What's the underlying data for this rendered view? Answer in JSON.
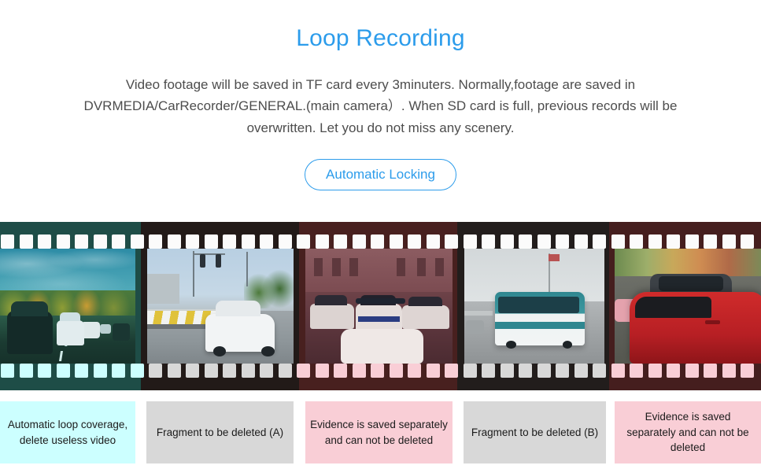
{
  "header": {
    "title": "Loop Recording",
    "description": "Video footage will be saved in TF card every 3minuters. Normally,footage are saved in DVRMEDIA/CarRecorder/GENERAL.(main camera）. When SD card is full, previous records will be overwritten. Let you do not miss any scenery.",
    "button_label": "Automatic Locking"
  },
  "colors": {
    "accent": "#2c9ceb",
    "title": "#2c9ceb",
    "body_text": "#4d4d4d",
    "film_base": "#1d1614",
    "caption_cyan": "#ccffff",
    "caption_gray": "#d8d8d8",
    "caption_pink": "#f9ced6",
    "page_background": "#ffffff"
  },
  "filmstrip": {
    "sprocket_hole_count": 41,
    "frames": [
      {
        "id": "frame-highway",
        "photo_name": "highway-dashcam-autumn-trees",
        "tint": "#ccffff",
        "band_tint": "#1e4d47",
        "caption": "Automatic loop coverage, delete useless video",
        "caption_background": "#ccffff"
      },
      {
        "id": "frame-city-road",
        "photo_name": "city-road-traffic-light-white-sedan",
        "tint": "#d8d8d8",
        "band_tint": "#221a18",
        "caption": "Fragment to be deleted (A)",
        "caption_background": "#d8d8d8"
      },
      {
        "id": "frame-police-cars",
        "photo_name": "police-cars-accident-scene",
        "tint": "#f9ced6",
        "band_tint": "#48201f",
        "caption": "Evidence is saved separately and can not be deleted",
        "caption_background": "#f9ced6"
      },
      {
        "id": "frame-bus",
        "photo_name": "city-bus-on-road",
        "tint": "#d8d8d8",
        "band_tint": "#221d1c",
        "caption": "Fragment to be deleted (B)",
        "caption_background": "#d8d8d8"
      },
      {
        "id": "frame-red-car",
        "photo_name": "red-car-collision-closeup",
        "tint": "#f9ced6",
        "band_tint": "#451e1e",
        "caption": "Evidence is saved separately and can not be deleted",
        "caption_background": "#f9ced6"
      }
    ]
  }
}
